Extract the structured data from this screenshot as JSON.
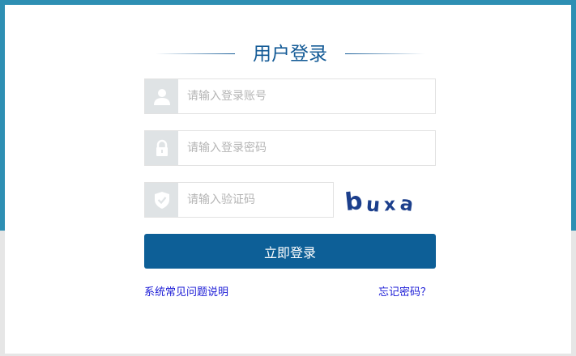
{
  "login": {
    "title": "用户登录",
    "account": {
      "placeholder": "请输入登录账号",
      "value": ""
    },
    "password": {
      "placeholder": "请输入登录密码",
      "value": ""
    },
    "captcha_field": {
      "placeholder": "请输入验证码",
      "value": ""
    },
    "captcha_chars": [
      "b",
      "u",
      "x",
      "a"
    ],
    "submit_label": "立即登录",
    "faq_link": "系统常见问题说明",
    "forgot_link": "忘记密码？"
  },
  "icons": {
    "account": "user-icon",
    "password": "lock-icon",
    "captcha": "shield-check-icon"
  },
  "colors": {
    "brand": "#0d5f97",
    "title": "#135a96",
    "top_band": "#2e8fb3",
    "link": "#1a1ad6",
    "icon_bg": "#dfe3e5",
    "captcha_text": "#1c3f8c"
  }
}
